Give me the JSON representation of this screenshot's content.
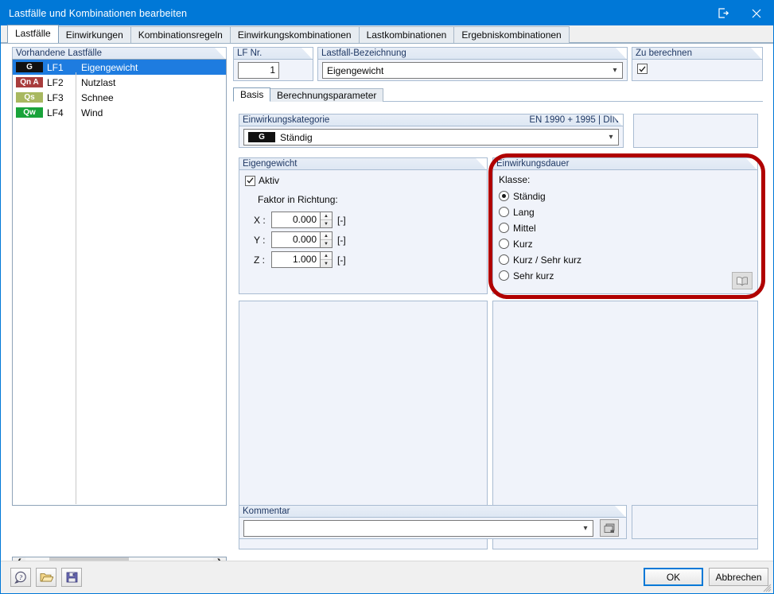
{
  "window": {
    "title": "Lastfälle und Kombinationen bearbeiten",
    "detach_icon": "detach-icon",
    "close_icon": "close-icon"
  },
  "tabs": [
    {
      "label": "Lastfälle",
      "active": true
    },
    {
      "label": "Einwirkungen",
      "active": false
    },
    {
      "label": "Kombinationsregeln",
      "active": false
    },
    {
      "label": "Einwirkungskombinationen",
      "active": false
    },
    {
      "label": "Lastkombinationen",
      "active": false
    },
    {
      "label": "Ergebniskombinationen",
      "active": false
    }
  ],
  "existing_load_cases": {
    "caption": "Vorhandene Lastfälle",
    "rows": [
      {
        "badge": "G",
        "badge_bg": "#111111",
        "badge_fg": "#ffffff",
        "no": "LF1",
        "name": "Eigengewicht",
        "selected": true
      },
      {
        "badge": "Qn A",
        "badge_bg": "#a83c3c",
        "badge_fg": "#ffffff",
        "no": "LF2",
        "name": "Nutzlast",
        "selected": false
      },
      {
        "badge": "Qs",
        "badge_bg": "#a8b860",
        "badge_fg": "#ffffff",
        "no": "LF3",
        "name": "Schnee",
        "selected": false
      },
      {
        "badge": "Qw",
        "badge_bg": "#19a33a",
        "badge_fg": "#ffffff",
        "no": "LF4",
        "name": "Wind",
        "selected": false
      }
    ],
    "scroll_left_icon": "chevron-left-icon",
    "scroll_right_icon": "chevron-right-icon",
    "toolbar": [
      {
        "name": "new-load-case-button",
        "icon": "new-window-icon",
        "enabled": true
      },
      {
        "name": "copy-load-case-button",
        "icon": "copy-window-icon",
        "enabled": true
      },
      {
        "name": "transfer-load-case-button",
        "icon": "transfer-icon",
        "enabled": false
      },
      {
        "name": "rename-load-case-button",
        "icon": "rename-icon",
        "enabled": true
      },
      {
        "name": "select-all-button",
        "icon": "check-list-icon",
        "enabled": true
      },
      {
        "name": "deselect-all-button",
        "icon": "uncheck-list-icon",
        "enabled": false
      },
      {
        "name": "invert-selection-button",
        "icon": "invert-list-icon",
        "enabled": true
      },
      {
        "name": "delete-load-case-button",
        "icon": "delete-x-icon",
        "enabled": true
      }
    ]
  },
  "lf_number": {
    "caption": "LF Nr.",
    "value": "1"
  },
  "lf_description": {
    "caption": "Lastfall-Bezeichnung",
    "value": "Eigengewicht",
    "dropdown_icon": "chevron-down-icon"
  },
  "to_calculate": {
    "caption": "Zu berechnen",
    "checked": true
  },
  "inner_tabs": [
    {
      "label": "Basis",
      "active": true
    },
    {
      "label": "Berechnungsparameter",
      "active": false
    }
  ],
  "action_category": {
    "caption": "Einwirkungskategorie",
    "caption_right": "EN 1990 + 1995 | DIN",
    "badge": "G",
    "badge_bg": "#111111",
    "badge_fg": "#ffffff",
    "value": "Ständig",
    "dropdown_icon": "chevron-down-icon"
  },
  "self_weight": {
    "caption": "Eigengewicht",
    "active_label": "Aktiv",
    "active_checked": true,
    "factor_label": "Faktor in Richtung:",
    "rows": [
      {
        "axis": "X :",
        "value": "0.000",
        "unit": "[-]"
      },
      {
        "axis": "Y :",
        "value": "0.000",
        "unit": "[-]"
      },
      {
        "axis": "Z :",
        "value": "1.000",
        "unit": "[-]"
      }
    ]
  },
  "action_duration": {
    "caption": "Einwirkungsdauer",
    "class_label": "Klasse:",
    "options": [
      {
        "label": "Ständig",
        "selected": true
      },
      {
        "label": "Lang",
        "selected": false
      },
      {
        "label": "Mittel",
        "selected": false
      },
      {
        "label": "Kurz",
        "selected": false
      },
      {
        "label": "Kurz / Sehr kurz",
        "selected": false
      },
      {
        "label": "Sehr kurz",
        "selected": false
      }
    ],
    "info_button_icon": "book-icon",
    "highlight_color": "#b00000"
  },
  "comment": {
    "caption": "Kommentar",
    "value": "",
    "dropdown_icon": "chevron-down-icon",
    "pick_button_icon": "windows-stack-icon"
  },
  "footer": {
    "help_icon": "help-question-icon",
    "open_icon": "open-folder-icon",
    "save_icon": "save-floppy-icon",
    "ok_label": "OK",
    "cancel_label": "Abbrechen"
  }
}
